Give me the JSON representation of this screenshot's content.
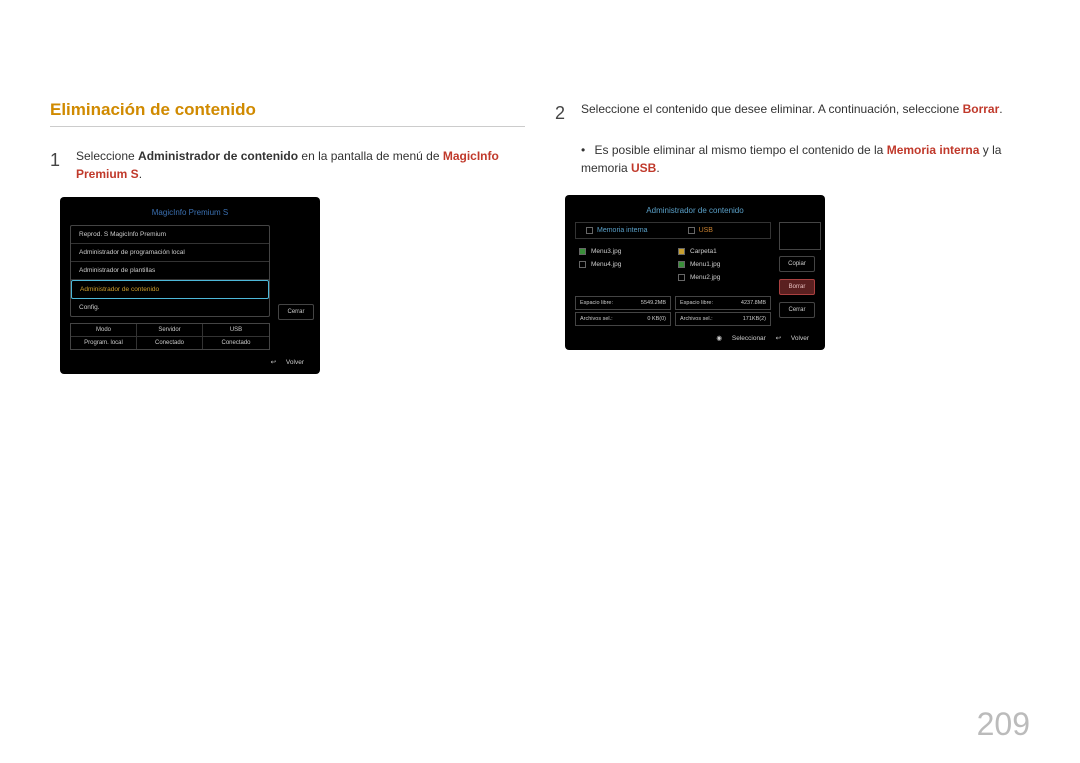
{
  "heading": "Eliminación de contenido",
  "step1": {
    "num": "1",
    "pre": "Seleccione ",
    "bold": "Administrador de contenido",
    "mid": " en la pantalla de menú de ",
    "red": "MagicInfo Premium S",
    "post": "."
  },
  "step2": {
    "num": "2",
    "pre": "Seleccione el contenido que desee eliminar. A continuación, seleccione ",
    "red": "Borrar",
    "post": "."
  },
  "note2": {
    "bullet": "•",
    "t1": "Es posible eliminar al mismo tiempo el contenido de la ",
    "b1": "Memoria interna",
    "t2": " y la memoria ",
    "b2": "USB",
    "post": "."
  },
  "screen1": {
    "title": "MagicInfo Premium S",
    "items": {
      "i1": "Reprod. S MagicInfo Premium",
      "i2": "Administrador de programación local",
      "i3": "Administrador de plantillas",
      "i4": "Administrador de contenido",
      "i5": "Config."
    },
    "btn_cerrar": "Cerrar",
    "grid": {
      "h1": "Modo",
      "h2": "Servidor",
      "h3": "USB",
      "v1": "Program. local",
      "v2": "Conectado",
      "v3": "Conectado"
    },
    "footer_return_icon": "↩",
    "footer_return": "Volver"
  },
  "screen2": {
    "title": "Administrador de contenido",
    "tab1": "Memoria interna",
    "tab2": "USB",
    "left": {
      "l1": "Menu3.jpg",
      "l2": "Menu4.jpg"
    },
    "right": {
      "r1": "Carpeta1",
      "r2": "Menu1.jpg",
      "r3": "Menu2.jpg"
    },
    "info": {
      "a1": "Espacio libre:",
      "a1v": "5549.2MB",
      "a2": "Archivos sel.:",
      "a2v": "0 KB(0)",
      "b1": "Espacio libre:",
      "b1v": "4237.8MB",
      "b2": "Archivos sel.:",
      "b2v": "171KB(2)"
    },
    "btns": {
      "copiar": "Copiar",
      "borrar": "Borrar",
      "cerrar": "Cerrar"
    },
    "footer_sel_icon": "◉",
    "footer_sel": "Seleccionar",
    "footer_ret_icon": "↩",
    "footer_ret": "Volver"
  },
  "pagenum": "209"
}
